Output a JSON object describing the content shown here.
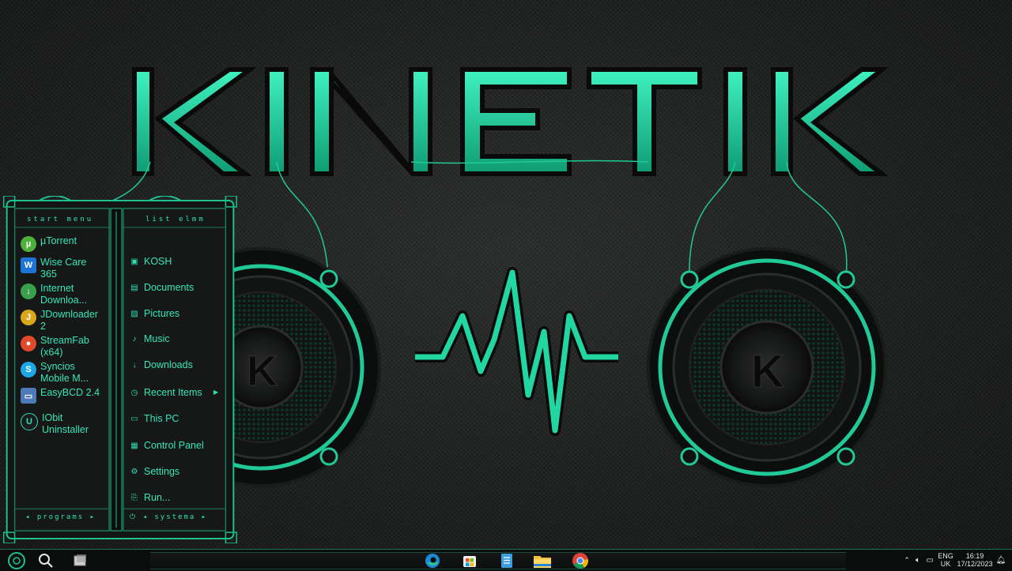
{
  "wallpaper": {
    "logo_text": "KINETIK",
    "accent": "#22d6a2",
    "speaker_badge": "K"
  },
  "start_menu": {
    "programs_header": "start menu",
    "system_header": "list elmm",
    "programs_footer": "programs",
    "system_footer": "systema",
    "programs": [
      {
        "label": "µTorrent",
        "icon": "utorrent-icon",
        "color": "#4eb23a"
      },
      {
        "label": "Wise Care 365",
        "icon": "wise-care-icon",
        "color": "#1e74d6"
      },
      {
        "label": "Internet Downloa...",
        "icon": "idm-icon",
        "color": "#3aa04c"
      },
      {
        "label": "JDownloader 2",
        "icon": "jdownloader-icon",
        "color": "#d9a71b"
      },
      {
        "label": "StreamFab (x64)",
        "icon": "streamfab-icon",
        "color": "#e04a2a"
      },
      {
        "label": "Syncios Mobile M...",
        "icon": "syncios-icon",
        "color": "#1fa6e6"
      },
      {
        "label": "EasyBCD 2.4",
        "icon": "easybcd-icon",
        "color": "#4d7ab8"
      },
      {
        "label": "IObit Uninstaller",
        "icon": "iobit-icon",
        "color": "#1b1c1c"
      }
    ],
    "system_items": [
      {
        "label": "KOSH",
        "icon": "user-folder-icon",
        "glyph": "▣"
      },
      {
        "label": "Documents",
        "icon": "documents-icon",
        "glyph": "▤"
      },
      {
        "label": "Pictures",
        "icon": "pictures-icon",
        "glyph": "▨"
      },
      {
        "label": "Music",
        "icon": "music-icon",
        "glyph": "♪"
      },
      {
        "label": "Downloads",
        "icon": "downloads-icon",
        "glyph": "↓"
      },
      {
        "label": "Recent Items",
        "icon": "recent-icon",
        "glyph": "◷"
      },
      {
        "label": "This PC",
        "icon": "computer-icon",
        "glyph": "▭"
      },
      {
        "label": "Control Panel",
        "icon": "control-panel-icon",
        "glyph": "▦"
      },
      {
        "label": "Settings",
        "icon": "settings-icon",
        "glyph": "⚙"
      },
      {
        "label": "Run...",
        "icon": "run-icon",
        "glyph": "⎘"
      }
    ]
  },
  "taskbar": {
    "language_top": "ENG",
    "language_bottom": "UK",
    "time": "16:19",
    "date": "17/12/2023"
  }
}
